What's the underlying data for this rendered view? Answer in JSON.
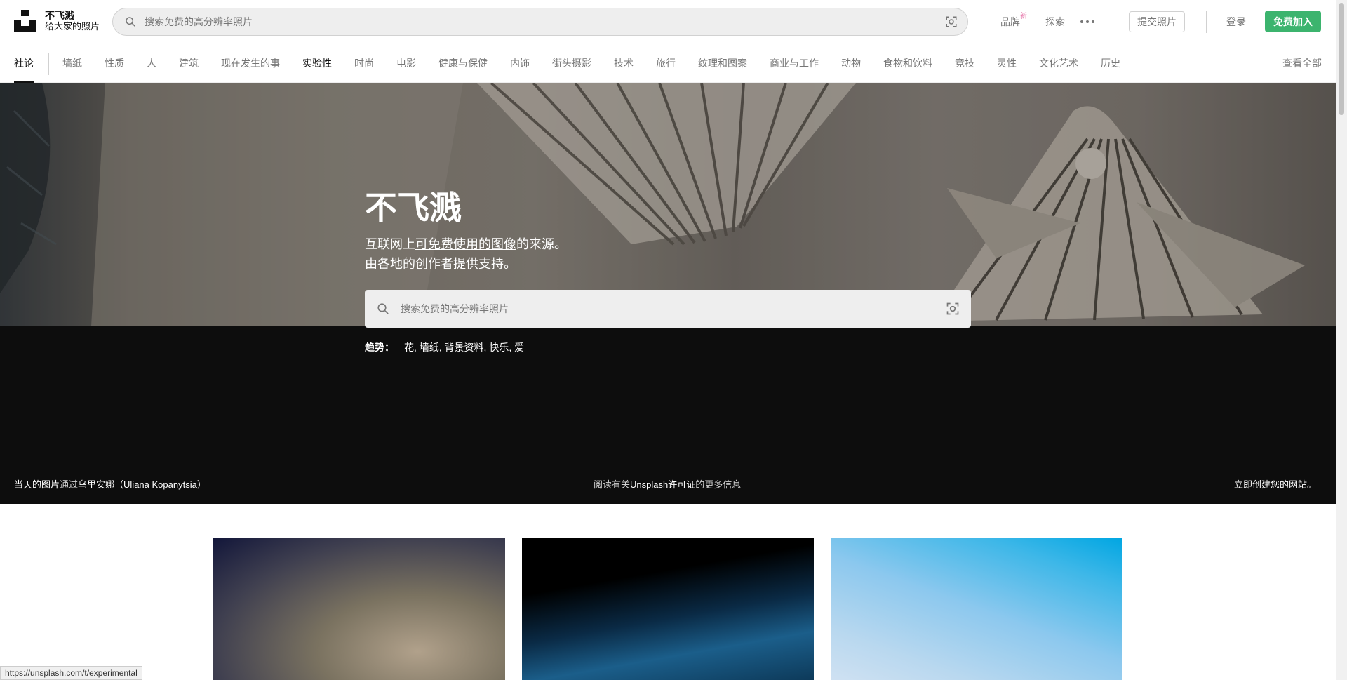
{
  "header": {
    "brand_name": "不飞溅",
    "brand_tagline": "给大家的照片",
    "search_placeholder": "搜索免费的高分辨率照片",
    "nav_brands": "品牌",
    "nav_brands_badge": "新",
    "nav_explore": "探索",
    "submit_label": "提交照片",
    "login_label": "登录",
    "join_label": "免费加入"
  },
  "categories": {
    "items": [
      "社论",
      "墙纸",
      "性质",
      "人",
      "建筑",
      "现在发生的事",
      "实验性",
      "时尚",
      "电影",
      "健康与保健",
      "内饰",
      "街头摄影",
      "技术",
      "旅行",
      "纹理和图案",
      "商业与工作",
      "动物",
      "食物和饮料",
      "竞技",
      "灵性",
      "文化艺术",
      "历史"
    ],
    "active": "社论",
    "highlighted": "实验性",
    "view_all": "查看全部"
  },
  "hero": {
    "title": "不飞溅",
    "subtitle_line1_pre": "互联网上",
    "subtitle_line1_link": "可免费使用的图像",
    "subtitle_line1_post": "的来源。",
    "subtitle_line2": "由各地的创作者提供支持。",
    "search_placeholder": "搜索免费的高分辨率照片",
    "trending_label": "趋势：",
    "trending_items": "花, 墙纸, 背景资料, 快乐, 爱",
    "footer_left_pre": "当天的图片",
    "footer_left_mid": "通过",
    "footer_left_author": "乌里安娜（Uliana Kopanytsia）",
    "footer_mid_pre": "阅读有关",
    "footer_mid_link": "Unsplash许可证",
    "footer_mid_post": "的更多信息",
    "footer_right": "立即创建您的网站。"
  },
  "status_url": "https://unsplash.com/t/experimental",
  "icons": {
    "logo": "unsplash-logo",
    "search": "search-icon",
    "visual_search": "visual-search-icon",
    "more": "more-dots-icon"
  },
  "colors": {
    "accent_green": "#3cb46e",
    "new_badge": "#e25c9a"
  }
}
